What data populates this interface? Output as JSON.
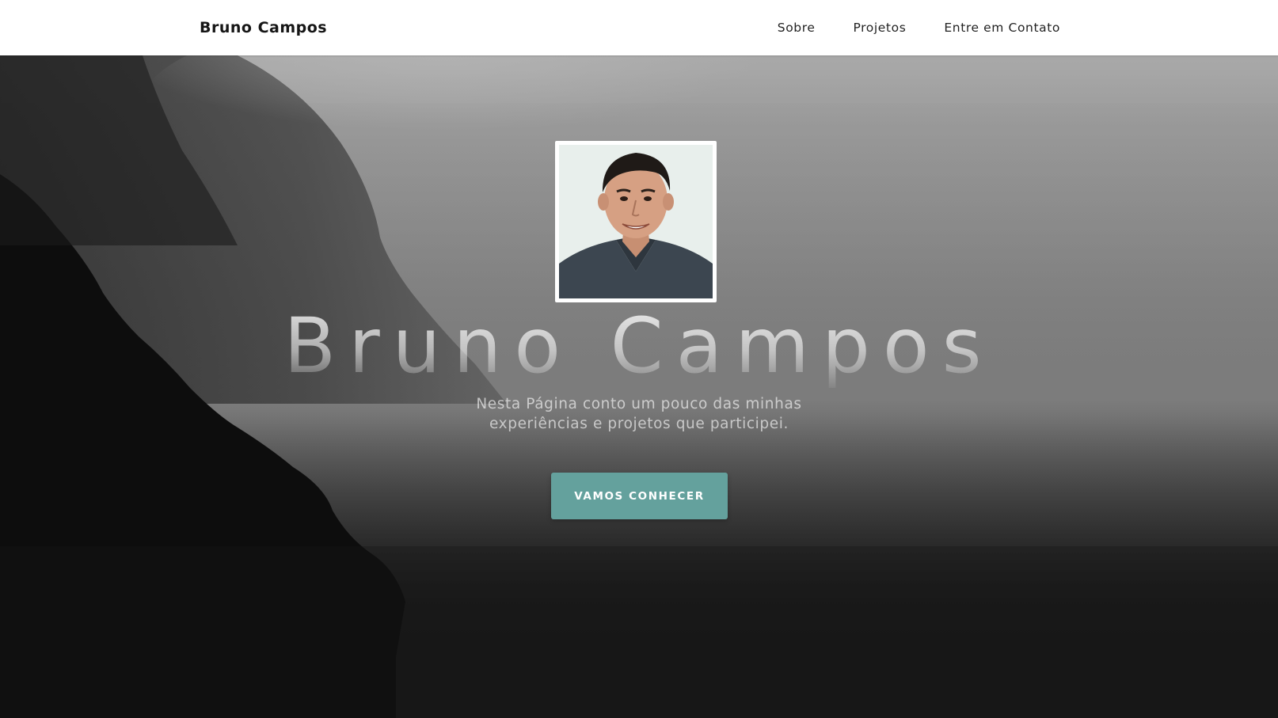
{
  "navbar": {
    "brand": "Bruno Campos",
    "links": [
      {
        "label": "Sobre"
      },
      {
        "label": "Projetos"
      },
      {
        "label": "Entre em Contato"
      }
    ]
  },
  "hero": {
    "title": "Bruno Campos",
    "subtitle": "Nesta Página conto um pouco das minhas experiências e projetos que participei.",
    "cta_label": "VAMOS CONHECER"
  },
  "colors": {
    "accent": "#64a19d",
    "navbar_bg": "#ffffff",
    "page_bg": "#181818"
  }
}
